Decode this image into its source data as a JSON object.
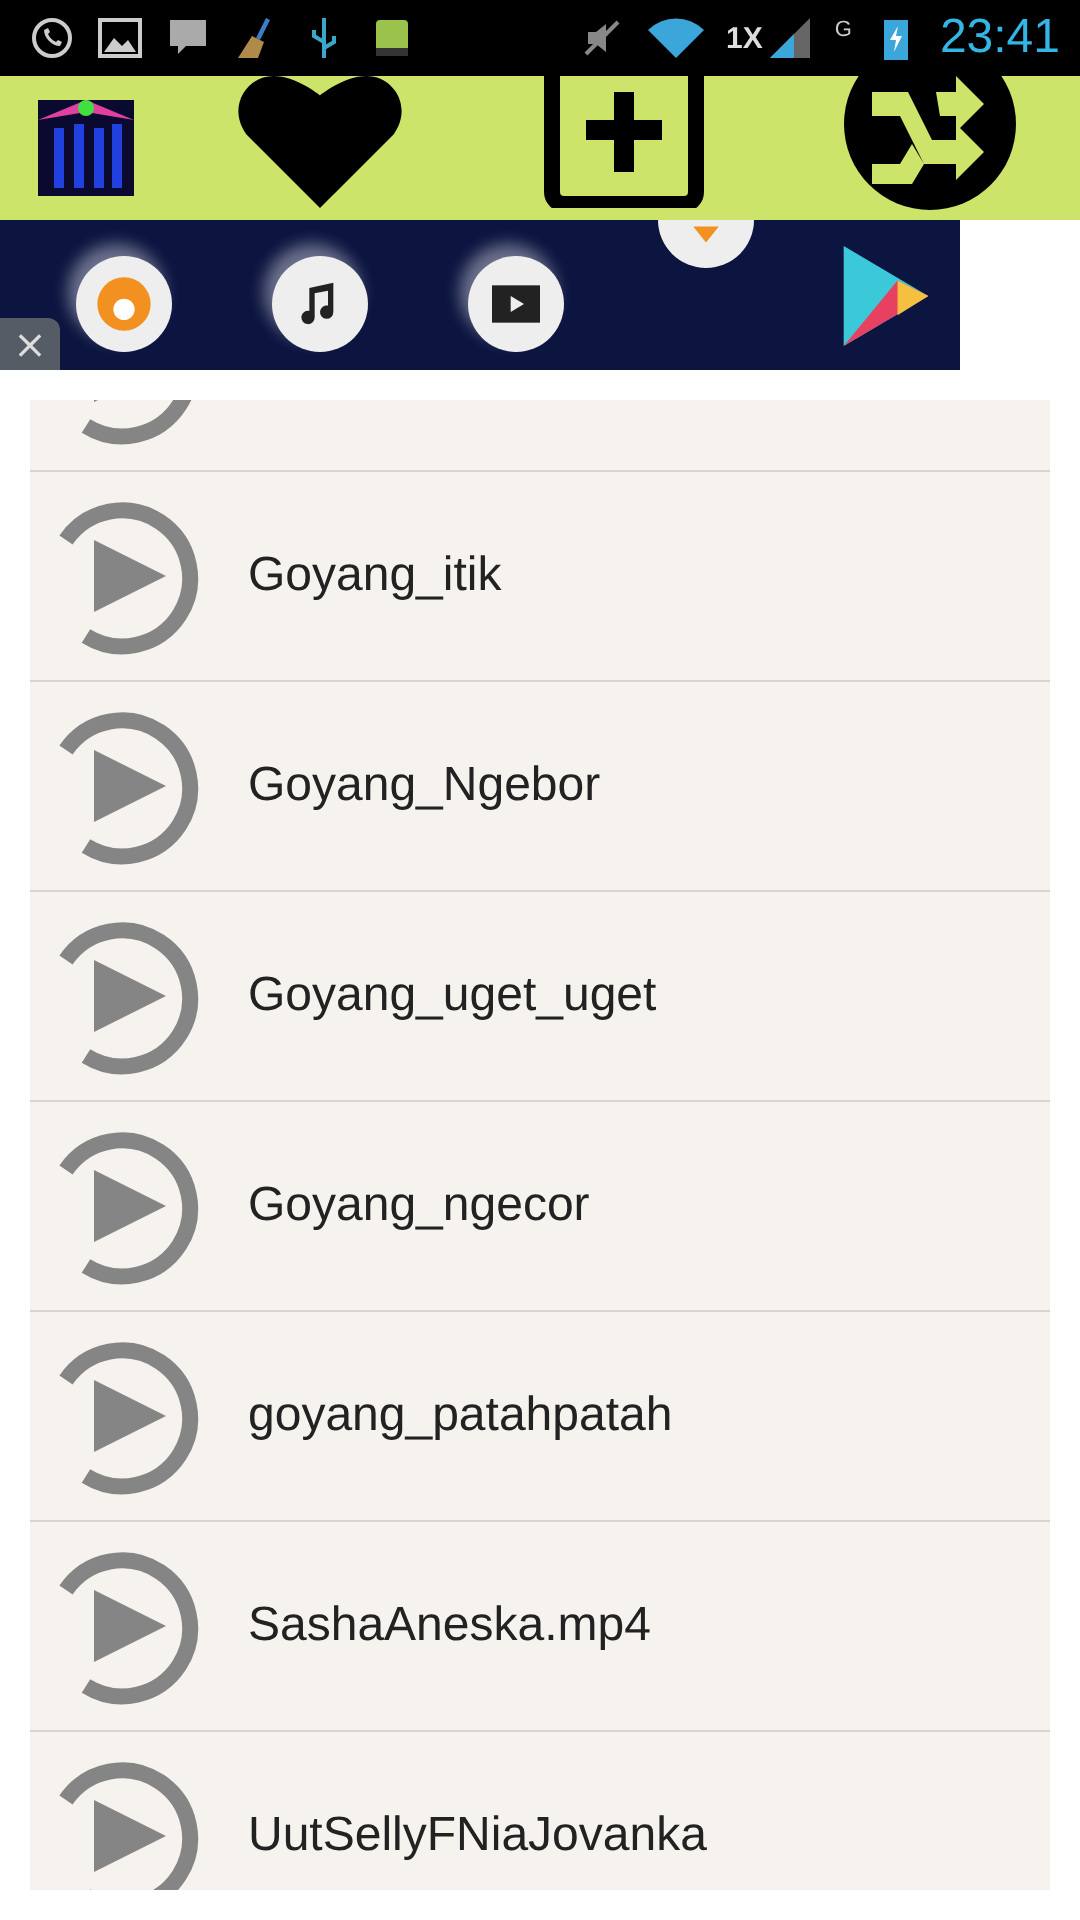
{
  "status_bar": {
    "network": "1X",
    "data_type": "G",
    "time": "23:41"
  },
  "ad_banner": {
    "close": "×"
  },
  "tracks": [
    {
      "title": "Goyang_itik"
    },
    {
      "title": "Goyang_Ngebor"
    },
    {
      "title": "Goyang_uget_uget"
    },
    {
      "title": "Goyang_ngecor"
    },
    {
      "title": "goyang_patahpatah"
    },
    {
      "title": "SashaAneska.mp4"
    },
    {
      "title": "UutSellyFNiaJovanka"
    }
  ]
}
